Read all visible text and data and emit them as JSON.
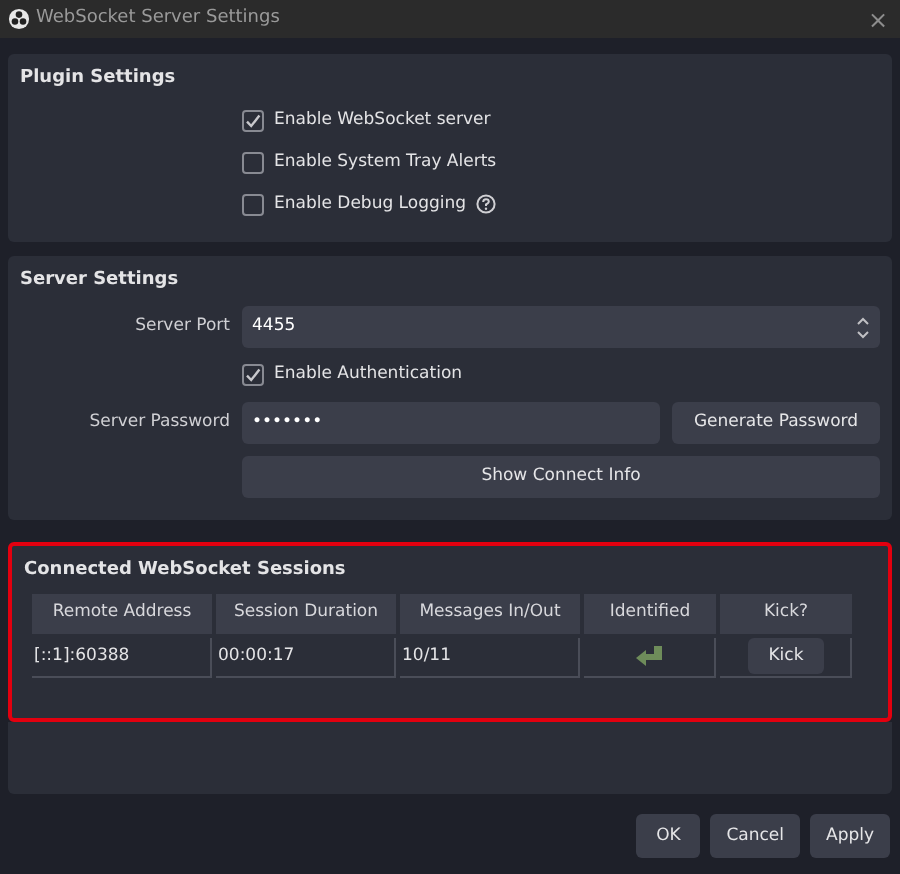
{
  "window": {
    "title": "WebSocket Server Settings",
    "close": "×"
  },
  "plugin_settings": {
    "title": "Plugin Settings",
    "options": [
      {
        "label": "Enable WebSocket server",
        "checked": true,
        "help": false
      },
      {
        "label": "Enable System Tray Alerts",
        "checked": false,
        "help": false
      },
      {
        "label": "Enable Debug Logging",
        "checked": false,
        "help": true
      }
    ]
  },
  "server_settings": {
    "title": "Server Settings",
    "port_label": "Server Port",
    "port": "4455",
    "auth": {
      "label": "Enable Authentication",
      "checked": true
    },
    "password_label": "Server Password",
    "password": "•••••••",
    "generate_button": "Generate Password",
    "connect_info_button": "Show Connect Info"
  },
  "sessions": {
    "title": "Connected WebSocket Sessions",
    "highlighted": true,
    "columns": [
      "Remote Address",
      "Session Duration",
      "Messages In/Out",
      "Identified",
      "Kick?"
    ],
    "rows": [
      {
        "remote_address": "[::1]:60388",
        "duration": "00:00:17",
        "messages": "10/11",
        "identified": true,
        "kick": "Kick"
      }
    ]
  },
  "buttons": [
    "OK",
    "Cancel",
    "Apply"
  ]
}
